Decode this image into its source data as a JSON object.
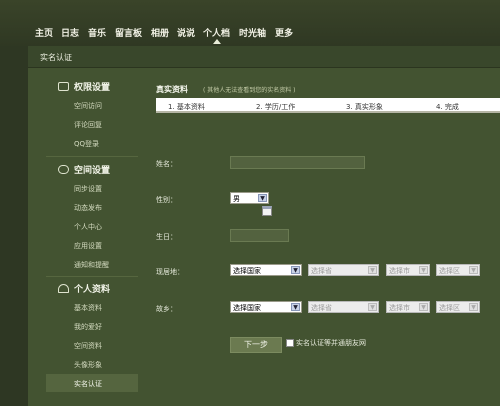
{
  "nav": {
    "items": [
      {
        "label": "主页"
      },
      {
        "label": "日志"
      },
      {
        "label": "音乐"
      },
      {
        "label": "留言板"
      },
      {
        "label": "相册"
      },
      {
        "label": "说说"
      },
      {
        "label": "个人档"
      },
      {
        "label": "时光轴"
      },
      {
        "label": "更多"
      }
    ],
    "active_label": "个人档"
  },
  "panel": {
    "title": "实名认证"
  },
  "sidebar": {
    "sections": [
      {
        "icon": "lock-icon",
        "label": "权限设置",
        "items": [
          {
            "label": "空间访问"
          },
          {
            "label": "评论回复"
          },
          {
            "label": "QQ登录"
          }
        ]
      },
      {
        "icon": "space-settings-icon",
        "label": "空间设置",
        "items": [
          {
            "label": "同步设置"
          },
          {
            "label": "动态发布"
          },
          {
            "label": "个人中心"
          },
          {
            "label": "应用设置"
          },
          {
            "label": "通知和提醒"
          }
        ]
      },
      {
        "icon": "user-profile-icon",
        "label": "个人资料",
        "items": [
          {
            "label": "基本资料"
          },
          {
            "label": "我的爱好"
          },
          {
            "label": "空间资料"
          },
          {
            "label": "头像形象"
          },
          {
            "label": "实名认证"
          }
        ]
      }
    ],
    "selected": "实名认证"
  },
  "content": {
    "title": "真实资料",
    "subtitle": "( 其他人无法查看到您的实名资料 )",
    "steps": [
      {
        "label": "1. 基本资料"
      },
      {
        "label": "2. 学历/工作"
      },
      {
        "label": "3. 真实形象"
      },
      {
        "label": "4. 完成"
      }
    ],
    "form": {
      "name_label": "姓名：",
      "name_value": "",
      "gender_label": "性别：",
      "gender_value": "男",
      "birthday_label": "生日：",
      "birthday_value": "",
      "residence_label": "现居地：",
      "hometown_label": "故乡：",
      "country_select": "选择国家",
      "province_select": "选择省",
      "city_select": "选择市",
      "district_select": "选择区"
    },
    "next_button": "下一步",
    "checkbox_label": "实名认证等并通朋友网"
  }
}
